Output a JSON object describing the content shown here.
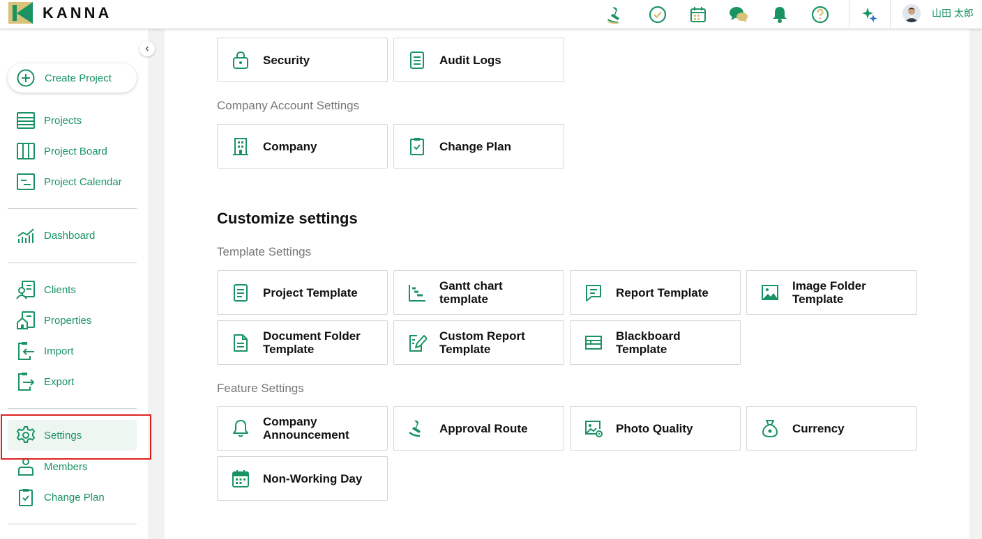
{
  "app": {
    "name": "KANNA"
  },
  "header": {
    "user_name": "山田 太郎",
    "icons": [
      "stamp-icon",
      "check-circle-icon",
      "calendar-icon",
      "chat-icon",
      "bell-icon",
      "help-icon",
      "sparkle-icon"
    ]
  },
  "sidebar": {
    "create_label": "Create Project",
    "items": [
      {
        "label": "Projects",
        "icon": "list-icon"
      },
      {
        "label": "Project Board",
        "icon": "board-icon"
      },
      {
        "label": "Project Calendar",
        "icon": "calendar-icon"
      },
      {
        "label": "Dashboard",
        "icon": "chart-icon"
      },
      {
        "label": "Clients",
        "icon": "clients-icon"
      },
      {
        "label": "Properties",
        "icon": "house-icon"
      },
      {
        "label": "Import",
        "icon": "import-icon"
      },
      {
        "label": "Export",
        "icon": "export-icon"
      },
      {
        "label": "Settings",
        "icon": "gear-icon",
        "active": true
      },
      {
        "label": "Members",
        "icon": "member-icon"
      },
      {
        "label": "Change Plan",
        "icon": "clipboard-check-icon"
      }
    ]
  },
  "main": {
    "top_cards": [
      {
        "label": "Security",
        "icon": "lock-icon"
      },
      {
        "label": "Audit Logs",
        "icon": "document-icon"
      }
    ],
    "company_section_label": "Company Account Settings",
    "company_cards": [
      {
        "label": "Company",
        "icon": "building-icon"
      },
      {
        "label": "Change Plan",
        "icon": "clipboard-check-icon"
      }
    ],
    "customize_heading": "Customize settings",
    "template_section_label": "Template Settings",
    "template_cards": [
      {
        "line1": "Project Template",
        "line2": "",
        "icon": "document-icon"
      },
      {
        "line1": "Gantt chart",
        "line2": "template",
        "icon": "gantt-icon"
      },
      {
        "line1": "Report Template",
        "line2": "",
        "icon": "report-icon"
      },
      {
        "line1": "Image Folder",
        "line2": "Template",
        "icon": "image-icon"
      },
      {
        "line1": "Document Folder",
        "line2": "Template",
        "icon": "file-icon"
      },
      {
        "line1": "Custom Report",
        "line2": "Template",
        "icon": "edit-report-icon"
      },
      {
        "line1": "Blackboard",
        "line2": "Template",
        "icon": "blackboard-icon"
      }
    ],
    "feature_section_label": "Feature Settings",
    "feature_cards": [
      {
        "line1": "Company",
        "line2": "Announcement",
        "icon": "bell-icon"
      },
      {
        "line1": "Approval Route",
        "line2": "",
        "icon": "stamp-icon"
      },
      {
        "line1": "Photo Quality",
        "line2": "",
        "icon": "photo-settings-icon"
      },
      {
        "line1": "Currency",
        "line2": "",
        "icon": "money-bag-icon"
      },
      {
        "line1": "Non-Working Day",
        "line2": "",
        "icon": "calendar-icon"
      }
    ]
  },
  "colors": {
    "accent": "#1a9363",
    "highlight": "#e02020",
    "logo_gold": "#d9c27a"
  }
}
